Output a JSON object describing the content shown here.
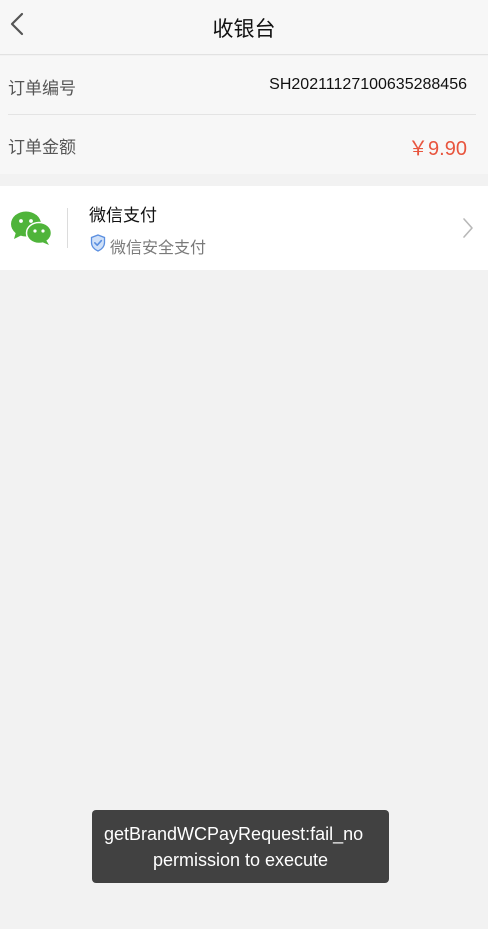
{
  "header": {
    "title": "收银台",
    "back_icon": "chevron-left-icon"
  },
  "order": {
    "number_label": "订单编号",
    "number_value": "SH20211127100635288456",
    "amount_label": "订单金额",
    "amount_value": "￥9.90"
  },
  "payment": {
    "method_name": "微信支付",
    "method_subtitle": "微信安全支付",
    "logo_icon": "wechat-icon",
    "secure_icon": "shield-check-icon",
    "arrow_icon": "chevron-right-icon"
  },
  "toast": {
    "line1": "getBrandWCPayRequest:fail_no",
    "line2": "permission to execute"
  },
  "colors": {
    "amount": "#e8553e",
    "wechat_green": "#4fb43a",
    "shield_blue": "#5b8fe0"
  }
}
